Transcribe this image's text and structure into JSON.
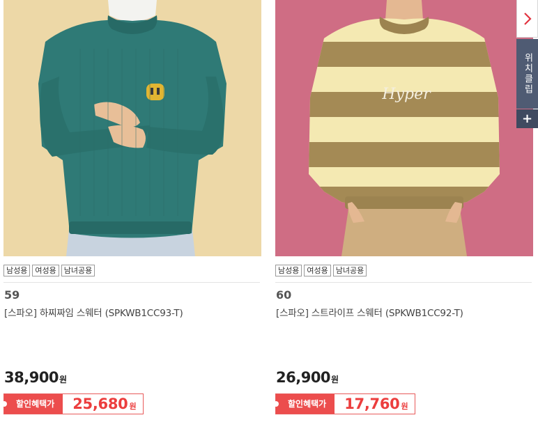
{
  "products": [
    {
      "rank": "59",
      "name": "[스파오] 하찌짜임 스웨터 (SPKWB1CC93-T)",
      "tags": [
        "남성용",
        "여성용",
        "남녀공용"
      ],
      "price": "38,900",
      "price_unit": "원",
      "sale_label": "할인혜택가",
      "sale_price": "25,680",
      "sale_unit": "원"
    },
    {
      "rank": "60",
      "name": "[스파오] 스트라이프 스웨터 (SPKWB1CC92-T)",
      "tags": [
        "남성용",
        "여성용",
        "남녀공용"
      ],
      "price": "26,900",
      "price_unit": "원",
      "sale_label": "할인혜택가",
      "sale_price": "17,760",
      "sale_unit": "원",
      "sweater_print": "Hyper"
    }
  ],
  "side": {
    "next_icon": "chevron-right-icon",
    "wish_label": "위치클립",
    "plus": "+"
  },
  "colors": {
    "sale_red": "#ec4d4d",
    "side_navy": "#4f5b73"
  }
}
